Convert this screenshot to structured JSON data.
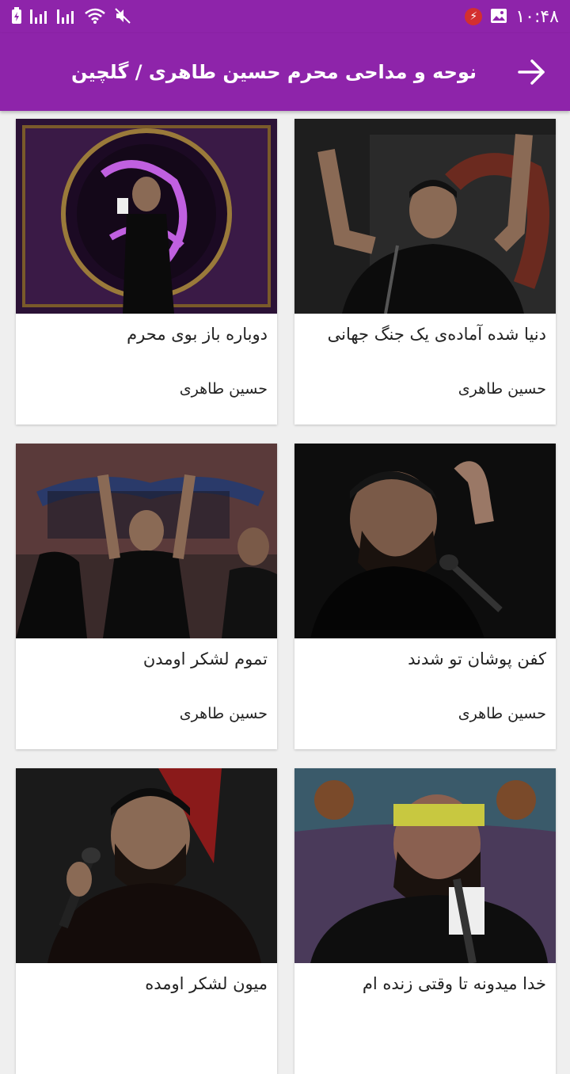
{
  "status_bar": {
    "time": "۱۰:۴۸",
    "icons": [
      "battery-charging-icon",
      "signal-icon",
      "signal-icon",
      "wifi-icon",
      "mute-icon",
      "flash-badge-icon",
      "image-icon"
    ]
  },
  "toolbar": {
    "title": "نوحه و مداحی محرم حسین طاهری / گلچین",
    "back_icon": "arrow-right-icon",
    "color": "#8e24aa"
  },
  "cards": [
    {
      "title": "دنیا شده آماده‌ی یک جنگ جهانی",
      "artist": "حسین طاهری"
    },
    {
      "title": "دوباره باز بوی محرم",
      "artist": "حسین طاهری"
    },
    {
      "title": "کفن پوشان تو شدند",
      "artist": "حسین طاهری"
    },
    {
      "title": "تموم لشکر اومدن",
      "artist": "حسین طاهری"
    },
    {
      "title": "خدا میدونه تا وقتی زنده ام",
      "artist": ""
    },
    {
      "title": "میون لشکر اومده",
      "artist": ""
    }
  ]
}
